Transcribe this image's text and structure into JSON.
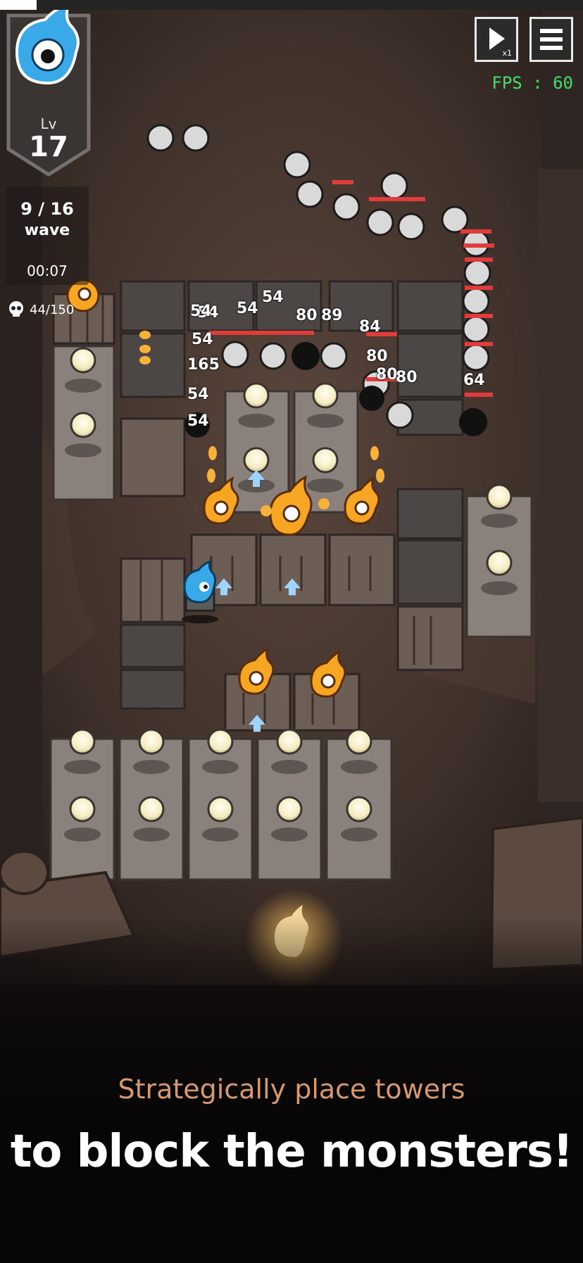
{
  "hud": {
    "level_label": "Lv",
    "level": "17",
    "wave_count": "9 / 16",
    "wave_label": "wave",
    "timer": "00:07",
    "kills": "44/150",
    "speed": "x1",
    "fps": "FPS : 60"
  },
  "damage_numbers": [
    "54",
    "54",
    "54",
    "80",
    "89",
    "84",
    "80",
    "80",
    "80",
    "64",
    "165",
    "54",
    "54",
    "64",
    "54",
    "54"
  ],
  "caption": {
    "subtitle": "Strategically place towers",
    "headline": "to block the monsters!"
  },
  "colors": {
    "fps": "#3fe06a",
    "subtitle": "#d79870",
    "player_blue": "#39a9e8",
    "fire_orange": "#f6a623",
    "health_red": "#e23b3b"
  },
  "icons": {
    "badge": "water-drop-mascot-icon",
    "speed": "play-icon",
    "menu": "hamburger-menu-icon",
    "kills": "skull-icon"
  }
}
